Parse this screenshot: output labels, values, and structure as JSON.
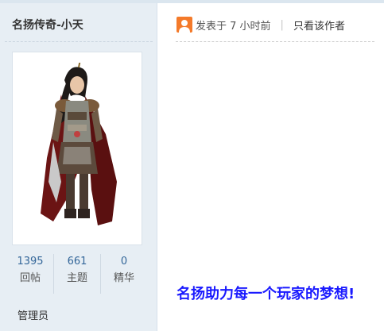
{
  "author": {
    "username": "名扬传奇-小天",
    "role": "管理员"
  },
  "stats": [
    {
      "value": "1395",
      "label": "回帖"
    },
    {
      "value": "661",
      "label": "主题"
    },
    {
      "value": "0",
      "label": "精华"
    }
  ],
  "post": {
    "posted_time": "发表于 7 小时前",
    "separator": "|",
    "author_only_link": "只看该作者",
    "body_text": "名扬助力每一个玩家的梦想!"
  },
  "colors": {
    "sidebar_bg": "#e7eef4",
    "stat_number": "#336699",
    "body_text": "#1a1aff",
    "user_icon": "#f47a2a"
  },
  "icons": {
    "user_icon": "user-icon"
  }
}
